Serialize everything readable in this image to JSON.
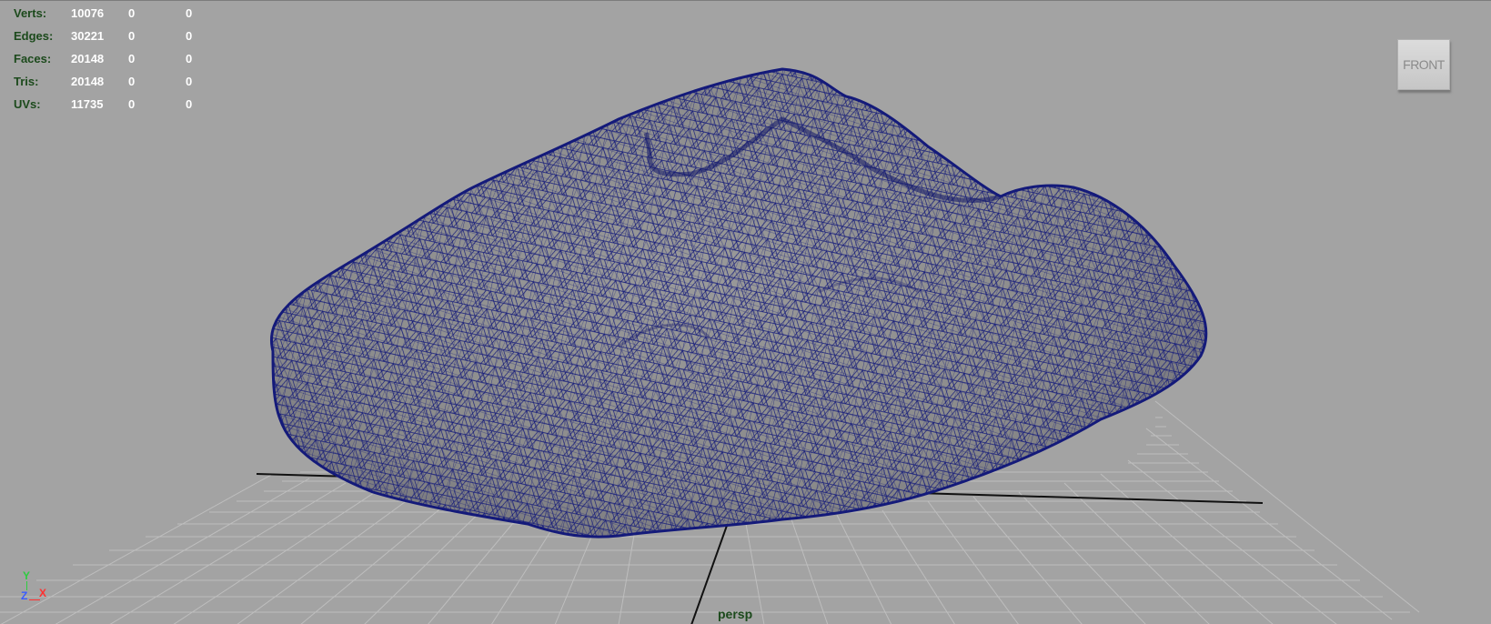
{
  "hud": {
    "rows": [
      {
        "label": "Verts:",
        "v1": "10076",
        "v2": "0",
        "v3": "0"
      },
      {
        "label": "Edges:",
        "v1": "30221",
        "v2": "0",
        "v3": "0"
      },
      {
        "label": "Faces:",
        "v1": "20148",
        "v2": "0",
        "v3": "0"
      },
      {
        "label": "Tris:",
        "v1": "20148",
        "v2": "0",
        "v3": "0"
      },
      {
        "label": "UVs:",
        "v1": "11735",
        "v2": "0",
        "v3": "0"
      }
    ]
  },
  "viewcube": {
    "face_label": "FRONT"
  },
  "axes": {
    "y": "Y",
    "z": "Z",
    "x": "X"
  },
  "camera_label": "persp",
  "colors": {
    "background": "#a3a3a3",
    "grid": "#bdbdbd",
    "wireframe": "#141a7a",
    "mesh_fill": "#8e8e8e",
    "hud_label": "#1c4a1c",
    "hud_value": "#ffffff"
  }
}
